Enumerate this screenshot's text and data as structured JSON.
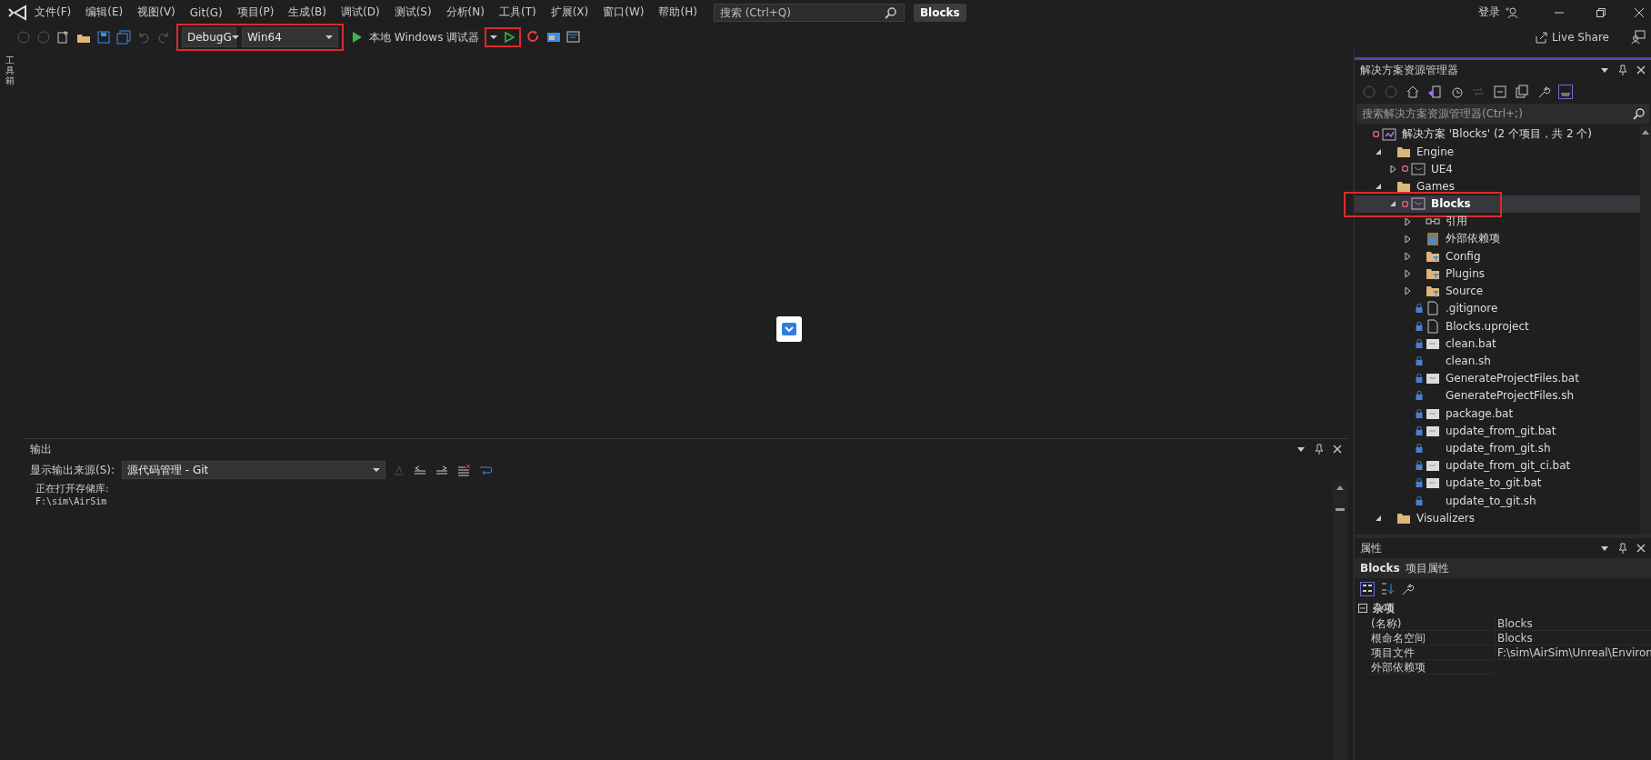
{
  "menu_bar": {
    "items": [
      "文件(F)",
      "编辑(E)",
      "视图(V)",
      "Git(G)",
      "项目(P)",
      "生成(B)",
      "调试(D)",
      "测试(S)",
      "分析(N)",
      "工具(T)",
      "扩展(X)",
      "窗口(W)",
      "帮助(H)"
    ],
    "search": {
      "placeholder": "搜索 (Ctrl+Q)"
    },
    "solution_name": "Blocks",
    "sign_in": "登录"
  },
  "toolbar": {
    "configuration": "DebugG",
    "platform": "Win64",
    "debugger": "本地 Windows 调试器",
    "config_highlighted": true,
    "run_highlighted": true,
    "live_share": "Live Share"
  },
  "side_tab": "工具箱",
  "output": {
    "title": "输出",
    "source_label": "显示输出来源(S):",
    "source": "源代码管理 - Git",
    "lines": [
      "正在打开存储库:",
      "F:\\sim\\AirSim"
    ]
  },
  "solution_explorer": {
    "title": "解决方案资源管理器",
    "search": {
      "placeholder": "搜索解决方案资源管理器(Ctrl+;)"
    },
    "tree": [
      {
        "label": "解决方案 'Blocks' (2 个项目，共 2 个)",
        "kind": "solution",
        "selected": false,
        "children": [
          {
            "label": "Engine",
            "kind": "folder",
            "expanded": true,
            "selected": false,
            "children": [
              {
                "label": "UE4",
                "kind": "project",
                "expanded": false,
                "selected": false
              }
            ]
          },
          {
            "label": "Games",
            "kind": "folder",
            "expanded": true,
            "selected": false,
            "children": [
              {
                "label": "Blocks",
                "kind": "project",
                "expanded": true,
                "selected": true,
                "highlighted": true,
                "children": [
                  {
                    "label": "引用",
                    "kind": "references",
                    "expanded": false,
                    "selected": false
                  },
                  {
                    "label": "外部依赖项",
                    "kind": "dependencies",
                    "expanded": false,
                    "selected": false
                  },
                  {
                    "label": "Config",
                    "kind": "filter",
                    "expanded": false,
                    "selected": false
                  },
                  {
                    "label": "Plugins",
                    "kind": "filter",
                    "expanded": false,
                    "selected": false
                  },
                  {
                    "label": "Source",
                    "kind": "filter",
                    "expanded": false,
                    "selected": false
                  },
                  {
                    "label": ".gitignore",
                    "kind": "document",
                    "selected": false
                  },
                  {
                    "label": "Blocks.uproject",
                    "kind": "document",
                    "selected": false
                  },
                  {
                    "label": "clean.bat",
                    "kind": "script",
                    "selected": false
                  },
                  {
                    "label": "clean.sh",
                    "kind": "shell",
                    "selected": false
                  },
                  {
                    "label": "GenerateProjectFiles.bat",
                    "kind": "script",
                    "selected": false
                  },
                  {
                    "label": "GenerateProjectFiles.sh",
                    "kind": "shell",
                    "selected": false
                  },
                  {
                    "label": "package.bat",
                    "kind": "script",
                    "selected": false
                  },
                  {
                    "label": "update_from_git.bat",
                    "kind": "script",
                    "selected": false
                  },
                  {
                    "label": "update_from_git.sh",
                    "kind": "shell",
                    "selected": false
                  },
                  {
                    "label": "update_from_git_ci.bat",
                    "kind": "script",
                    "selected": false
                  },
                  {
                    "label": "update_to_git.bat",
                    "kind": "script",
                    "selected": false
                  },
                  {
                    "label": "update_to_git.sh",
                    "kind": "shell",
                    "selected": false
                  }
                ]
              }
            ]
          },
          {
            "label": "Visualizers",
            "kind": "folder",
            "expanded": true,
            "selected": false
          }
        ]
      }
    ]
  },
  "properties": {
    "title": "属性",
    "object": "Blocks",
    "object_type": "项目属性",
    "categories": [
      {
        "label": "杂项",
        "expanded": true,
        "rows": [
          {
            "name": "(名称)",
            "value": "Blocks"
          },
          {
            "name": "根命名空间",
            "value": "Blocks"
          },
          {
            "name": "项目文件",
            "value": "F:\\sim\\AirSim\\Unreal\\Environ"
          },
          {
            "name": "外部依赖项"
          }
        ]
      }
    ]
  }
}
